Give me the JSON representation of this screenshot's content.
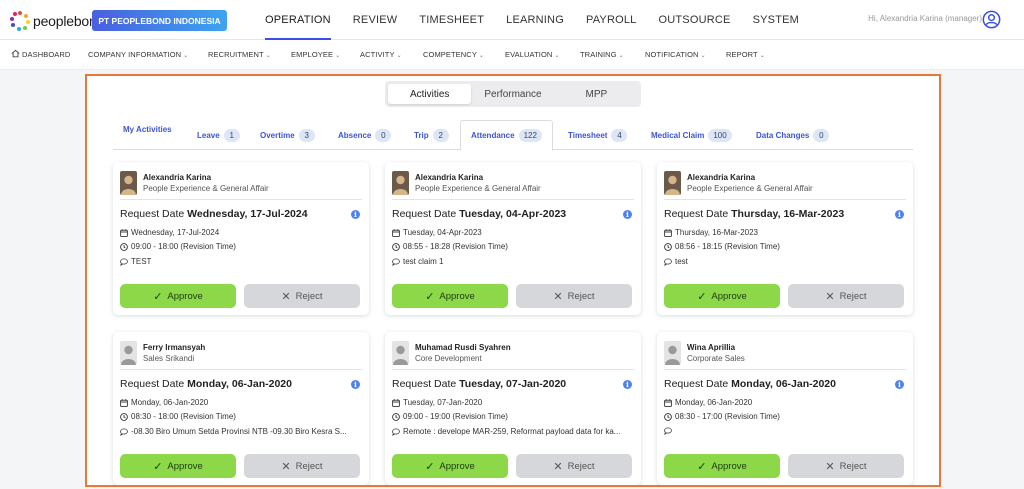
{
  "app": {
    "brand": "peoplebond",
    "company": "PT PEOPLEBOND INDONESIA",
    "greeting": "Hi, Alexandria Karina (manager)"
  },
  "main_nav": [
    "OPERATION",
    "REVIEW",
    "TIMESHEET",
    "LEARNING",
    "PAYROLL",
    "OUTSOURCE",
    "SYSTEM"
  ],
  "sub_nav": [
    "DASHBOARD",
    "COMPANY INFORMATION",
    "RECRUITMENT",
    "EMPLOYEE",
    "ACTIVITY",
    "COMPETENCY",
    "EVALUATION",
    "TRAINING",
    "NOTIFICATION",
    "REPORT"
  ],
  "segments": [
    "Activities",
    "Performance",
    "MPP"
  ],
  "tabs": [
    {
      "label": "My Activities",
      "count": ""
    },
    {
      "label": "Leave",
      "count": "1"
    },
    {
      "label": "Overtime",
      "count": "3"
    },
    {
      "label": "Absence",
      "count": "0"
    },
    {
      "label": "Trip",
      "count": "2"
    },
    {
      "label": "Attendance",
      "count": "122"
    },
    {
      "label": "Timesheet",
      "count": "4"
    },
    {
      "label": "Medical Claim",
      "count": "100"
    },
    {
      "label": "Data Changes",
      "count": "0"
    }
  ],
  "labels": {
    "request_date": "Request Date",
    "approve": "Approve",
    "reject": "Reject"
  },
  "cards": [
    {
      "name": "Alexandria Karina",
      "dept": "People Experience & General Affair",
      "request_date": "Wednesday, 17-Jul-2024",
      "date": "Wednesday, 17-Jul-2024",
      "time": "09:00 - 18:00 (Revision Time)",
      "note": "TEST"
    },
    {
      "name": "Alexandria Karina",
      "dept": "People Experience & General Affair",
      "request_date": "Tuesday, 04-Apr-2023",
      "date": "Tuesday, 04-Apr-2023",
      "time": "08:55 - 18:28 (Revision Time)",
      "note": "test claim 1"
    },
    {
      "name": "Alexandria Karina",
      "dept": "People Experience & General Affair",
      "request_date": "Thursday, 16-Mar-2023",
      "date": "Thursday, 16-Mar-2023",
      "time": "08:56 - 18:15 (Revision Time)",
      "note": "test"
    },
    {
      "name": "Ferry Irmansyah",
      "dept": "Sales Srikandi",
      "request_date": "Monday, 06-Jan-2020",
      "date": "Monday, 06-Jan-2020",
      "time": "08:30 - 18:00 (Revision Time)",
      "note": "-08.30 Biro Umum Setda Provinsi NTB -09.30 Biro Kesra S..."
    },
    {
      "name": "Muhamad Rusdi Syahren",
      "dept": "Core Development",
      "request_date": "Tuesday, 07-Jan-2020",
      "date": "Tuesday, 07-Jan-2020",
      "time": "09:00 - 19:00 (Revision Time)",
      "note": "Remote : develope MAR-259, Reformat payload data for ka..."
    },
    {
      "name": "Wina Aprillia",
      "dept": "Corporate Sales",
      "request_date": "Monday, 06-Jan-2020",
      "date": "Monday, 06-Jan-2020",
      "time": "08:30 - 17:00 (Revision Time)",
      "note": ""
    }
  ],
  "colors": {
    "accent": "#3b50e0",
    "approve": "#8cd849",
    "reject": "#d5d7da",
    "frame_border": "#e8773a",
    "info": "#4d82f0"
  }
}
